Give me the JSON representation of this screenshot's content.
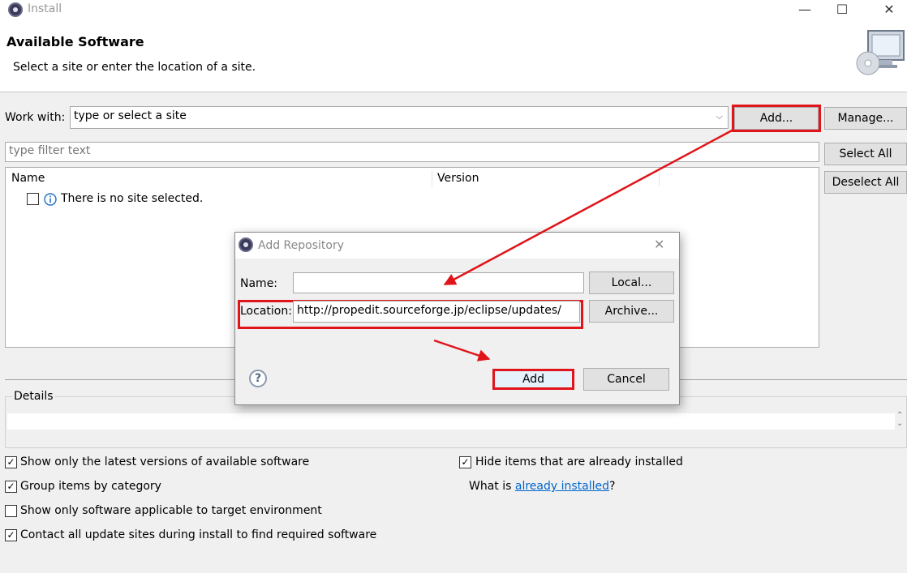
{
  "window": {
    "title": "Install",
    "minimize": "—",
    "maximize": "☐",
    "close": "✕"
  },
  "header": {
    "title": "Available Software",
    "subtitle": "Select a site or enter the location of a site."
  },
  "work_with": {
    "label": "Work with:",
    "value": "type or select a site",
    "add_label": "Add...",
    "manage_label": "Manage..."
  },
  "filter": {
    "placeholder": "type filter text"
  },
  "side_buttons": {
    "select_all": "Select All",
    "deselect_all": "Deselect All"
  },
  "table": {
    "columns": [
      "Name",
      "Version"
    ],
    "rows": [
      {
        "text": "There is no site selected.",
        "checked": false
      }
    ]
  },
  "details": {
    "label": "Details"
  },
  "options": {
    "show_latest": {
      "label": "Show only the latest versions of available software",
      "checked": true
    },
    "group_by_category": {
      "label": "Group items by category",
      "checked": true
    },
    "show_applicable": {
      "label": "Show only software applicable to target environment",
      "checked": false
    },
    "contact_all": {
      "label": "Contact all update sites during install to find required software",
      "checked": true
    },
    "hide_installed": {
      "label": "Hide items that are already installed",
      "checked": true
    },
    "what_is_prefix": "What is ",
    "what_is_link": "already installed",
    "what_is_suffix": "?"
  },
  "dialog": {
    "title": "Add Repository",
    "name_label": "Name:",
    "name_value": "",
    "location_label": "Location:",
    "location_value": "http://propedit.sourceforge.jp/eclipse/updates/",
    "local_button": "Local...",
    "archive_button": "Archive...",
    "add_button": "Add",
    "cancel_button": "Cancel",
    "help_symbol": "?"
  },
  "colors": {
    "highlight": "#e0141a",
    "link": "#0066cc"
  }
}
